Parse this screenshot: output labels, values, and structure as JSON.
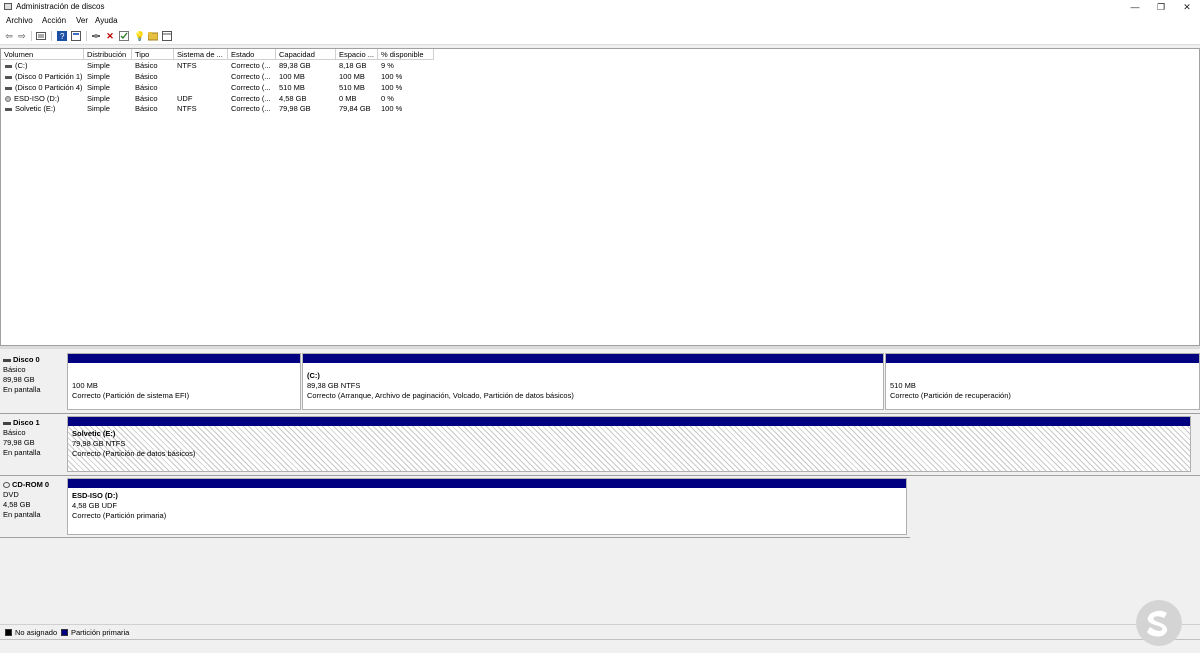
{
  "window": {
    "title": "Administración de discos",
    "minimize": "—",
    "restore": "❐",
    "close": "✕"
  },
  "menu": [
    "Archivo",
    "Acción",
    "Ver",
    "Ayuda"
  ],
  "toolbar_icons": [
    "back-icon",
    "forward-icon",
    "properties-icon",
    "help-icon",
    "list-icon",
    "connect-icon",
    "delete-icon",
    "check-icon",
    "bulb-icon",
    "folder-icon",
    "view-icon"
  ],
  "columns": [
    "Volumen",
    "Distribución",
    "Tipo",
    "Sistema de ...",
    "Estado",
    "Capacidad",
    "Espacio ...",
    "% disponible"
  ],
  "volumes": [
    {
      "name": "(C:)",
      "icon": "drive",
      "layout": "Simple",
      "type": "Básico",
      "fs": "NTFS",
      "status": "Correcto (...",
      "capacity": "89,38 GB",
      "free": "8,18 GB",
      "pct": "9 %"
    },
    {
      "name": "(Disco 0 Partición 1)",
      "icon": "drive",
      "layout": "Simple",
      "type": "Básico",
      "fs": "",
      "status": "Correcto (...",
      "capacity": "100 MB",
      "free": "100 MB",
      "pct": "100 %"
    },
    {
      "name": "(Disco 0 Partición 4)",
      "icon": "drive",
      "layout": "Simple",
      "type": "Básico",
      "fs": "",
      "status": "Correcto (...",
      "capacity": "510 MB",
      "free": "510 MB",
      "pct": "100 %"
    },
    {
      "name": "ESD-ISO (D:)",
      "icon": "cd",
      "layout": "Simple",
      "type": "Básico",
      "fs": "UDF",
      "status": "Correcto (...",
      "capacity": "4,58 GB",
      "free": "0 MB",
      "pct": "0 %"
    },
    {
      "name": "Solvetic (E:)",
      "icon": "drive",
      "layout": "Simple",
      "type": "Básico",
      "fs": "NTFS",
      "status": "Correcto (...",
      "capacity": "79,98 GB",
      "free": "79,84 GB",
      "pct": "100 %"
    }
  ],
  "disks": [
    {
      "name": "Disco 0",
      "type": "Básico",
      "size": "89,98 GB",
      "state": "En pantalla",
      "partitions": [
        {
          "name": "",
          "size": "100 MB",
          "status": "Correcto (Partición de sistema EFI)"
        },
        {
          "name": "(C:)",
          "size": "89,38 GB NTFS",
          "status": "Correcto (Arranque, Archivo de paginación, Volcado, Partición de datos básicos)"
        },
        {
          "name": "",
          "size": "510 MB",
          "status": "Correcto (Partición de recuperación)"
        }
      ]
    },
    {
      "name": "Disco 1",
      "type": "Básico",
      "size": "79,98 GB",
      "state": "En pantalla",
      "partitions": [
        {
          "name": "Solvetic  (E:)",
          "size": "79,98 GB NTFS",
          "status": "Correcto (Partición de datos básicos)"
        }
      ]
    },
    {
      "name": "CD-ROM 0",
      "type": "DVD",
      "size": "4,58 GB",
      "state": "En pantalla",
      "partitions": [
        {
          "name": "ESD-ISO  (D:)",
          "size": "4,58 GB UDF",
          "status": "Correcto (Partición primaria)"
        }
      ]
    }
  ],
  "legend": [
    {
      "label": "No asignado",
      "color": "#000000"
    },
    {
      "label": "Partición primaria",
      "color": "#000080"
    }
  ]
}
